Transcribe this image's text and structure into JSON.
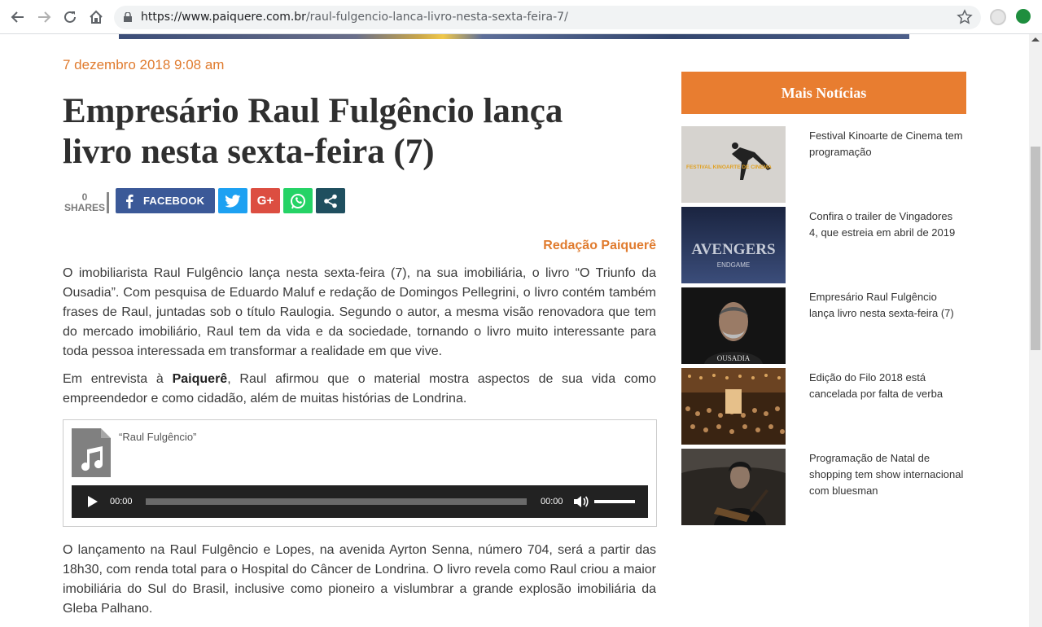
{
  "browser": {
    "url_host": "https://www.paiquere.com.br",
    "url_path": "/raul-fulgencio-lanca-livro-nesta-sexta-feira-7/"
  },
  "article": {
    "date": "7 dezembro 2018 9:08 am",
    "title": "Empresário Raul Fulgêncio lança livro nesta sexta-feira (7)",
    "shares_count": "0",
    "shares_label": "SHARES",
    "facebook_label": "FACEBOOK",
    "gplus_label": "G+",
    "author": "Redação Paiquerê",
    "paragraph1": "O imobiliarista Raul Fulgêncio lança nesta sexta-feira (7), na sua imobiliária, o livro “O Triunfo da Ousadia”. Com pesquisa de Eduardo Maluf e redação de Domingos Pellegrini, o livro contém também frases de Raul, juntadas sob o título Raulogia. Segundo o autor, a mesma visão renovadora que tem do mercado imobiliário, Raul tem da vida e da sociedade, tornando o livro muito interessante para toda pessoa interessada em transformar a realidade em que vive.",
    "paragraph2_pre": "Em entrevista à ",
    "paragraph2_bold": "Paiquerê",
    "paragraph2_post": ", Raul afirmou que o material mostra aspectos de sua vida como empreendedor e como cidadão, além de muitas histórias de Londrina.",
    "audio_caption": "“Raul Fulgêncio”",
    "audio_time_current": "00:00",
    "audio_time_total": "00:00",
    "paragraph3": "O lançamento na Raul Fulgêncio e Lopes, na avenida Ayrton Senna, número 704, será a partir das 18h30, com renda total para o Hospital do Câncer de Londrina. O livro revela como Raul criou a maior imobiliária do Sul do Brasil, inclusive como pioneiro a vislumbrar a grande explosão imobiliária da Gleba Palhano."
  },
  "sidebar": {
    "heading": "Mais Notícias",
    "items": [
      {
        "title": "Festival Kinoarte de Cinema tem programação",
        "thumb_text": "FESTIVAL KINOARTE DE CINEMA"
      },
      {
        "title": "Confira o trailer de Vingadores 4, que estreia em abril de 2019",
        "thumb_text": "AVENGERS",
        "thumb_sub": "ENDGAME"
      },
      {
        "title": "Empresário Raul Fulgêncio lança livro nesta sexta-feira (7)",
        "thumb_text": "OUSADIA"
      },
      {
        "title": "Edição do Filo 2018 está cancelada por falta de verba"
      },
      {
        "title": "Programação de Natal de shopping tem show internacional com bluesman"
      }
    ]
  },
  "colors": {
    "accent": "#e07b2e",
    "sidebar_heading_bg": "#e87d30",
    "facebook": "#3b5998",
    "twitter": "#1da1f2",
    "gplus": "#dc4e41",
    "whatsapp": "#25d366",
    "share": "#1f4f5f"
  }
}
